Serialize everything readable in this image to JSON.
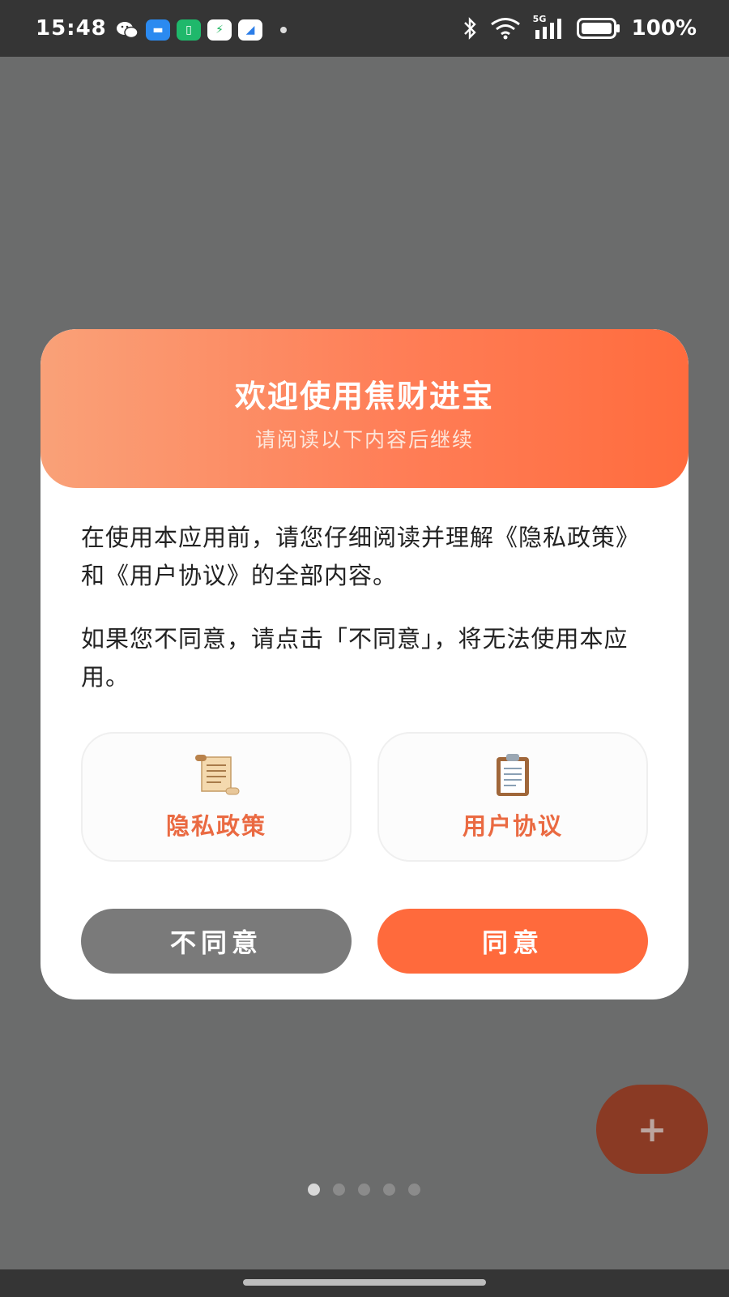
{
  "status_bar": {
    "time": "15:48",
    "network": "5G",
    "battery": "100%"
  },
  "dialog": {
    "title": "欢迎使用焦财进宝",
    "subtitle": "请阅读以下内容后继续",
    "paragraph1": "在使用本应用前，请您仔细阅读并理解《隐私政策》和《用户协议》的全部内容。",
    "paragraph2": "如果您不同意，请点击「不同意」，将无法使用本应用。",
    "doc_links": [
      {
        "label": "隐私政策",
        "icon": "scroll-icon"
      },
      {
        "label": "用户协议",
        "icon": "clipboard-icon"
      }
    ],
    "disagree_label": "不同意",
    "agree_label": "同意"
  },
  "fab": {
    "label": "+"
  },
  "pager": {
    "count": 5,
    "active_index": 0
  },
  "colors": {
    "accent": "#ff6a3c",
    "header_gradient_start": "#f9a178",
    "header_gradient_end": "#ff6c3e",
    "link_text": "#ea6a42",
    "disagree_button": "#7a7a7a",
    "overlay_background": "#6b6c6c"
  }
}
